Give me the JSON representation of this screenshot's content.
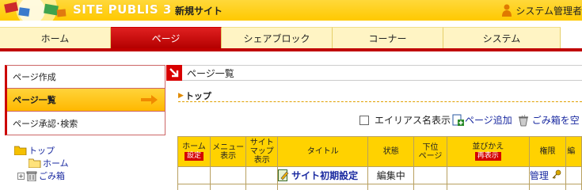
{
  "header": {
    "app_name": "SITE PUBLIS 3",
    "site_name": "新規サイト",
    "user_label": "システム管理者",
    "user_icon": "person-icon",
    "brand_color": "#ffc900"
  },
  "nav": {
    "tabs": [
      {
        "label": "ホーム",
        "active": false
      },
      {
        "label": "ページ",
        "active": true
      },
      {
        "label": "シェアブロック",
        "active": false
      },
      {
        "label": "コーナー",
        "active": false
      },
      {
        "label": "システム",
        "active": false
      }
    ],
    "active_color": "#c00000"
  },
  "left_menu": {
    "items": [
      {
        "label": "ページ作成",
        "active": false
      },
      {
        "label": "ページ一覧",
        "active": true
      },
      {
        "label": "ページ承認･検索",
        "active": false
      }
    ]
  },
  "tree": {
    "root": "トップ",
    "children": [
      {
        "label": "ホーム",
        "icon": "folder-icon"
      },
      {
        "label": "ごみ箱",
        "icon": "trash-icon",
        "expandable": true
      }
    ]
  },
  "main": {
    "title": "ページ一覧",
    "breadcrumb": "トップ",
    "alias_label": "エイリアス名表示",
    "alias_checked": false,
    "add_page": "ページ追加",
    "trash_link": "ごみ箱を空"
  },
  "table": {
    "headers": {
      "home_line": "ホーム",
      "home_button": "設定",
      "menu": "メニュー\n表示",
      "sitemap": "サイト\nマップ\n表示",
      "title": "タイトル",
      "status": "状態",
      "sub": "下位\nページ",
      "sort_line": "並びかえ",
      "sort_button": "再表示",
      "permission": "権限",
      "extra": "編"
    },
    "rows": [
      {
        "title": "サイト初期設定",
        "status": "編集中",
        "permission": "管理"
      }
    ]
  }
}
